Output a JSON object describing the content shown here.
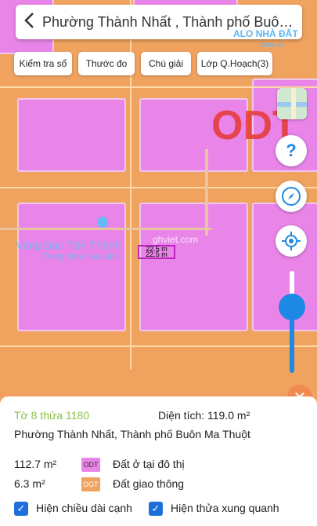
{
  "header": {
    "back_icon": "chevron-left-icon",
    "title": "Phường Thành Nhất , Thành phố Buôn Ma Thuột"
  },
  "watermark": {
    "brand": "ALO NHÀ ĐẤT",
    "domain": ".com.vn"
  },
  "toolbar": {
    "check_book": "Kiểm tra sổ",
    "measure": "Thước đo",
    "legend": "Chú giải",
    "planning_layer": "Lớp Q.Hoạch(3)"
  },
  "map": {
    "shop_label": "Vàng Bạc Tiến Thành",
    "mall_label": "Trung tâm mua sắm",
    "site_label": "ghviet.com",
    "dim_top": "22.5 m",
    "dim_bottom": "22.5 m",
    "zone_label": "ODT"
  },
  "controls": {
    "zoom_level": 0.35
  },
  "panel": {
    "parcel": "Tờ 8 thửa 1180",
    "area": "Diện tích: 119.0 m²",
    "address": "Phường Thành Nhất, Thành phố Buôn Ma Thuột",
    "land_uses": [
      {
        "amount": "112.7 m²",
        "code": "ODT",
        "name": "Đất ở tại đô thị",
        "color": "#e985e8"
      },
      {
        "amount": "6.3 m²",
        "code": "DGT",
        "name": "Đất giao thông",
        "color": "#f0a25f"
      }
    ],
    "show_edge_length": "Hiện chiều dài cạnh",
    "show_neighbors": "Hiện thửa xung quanh"
  },
  "colors": {
    "accent": "#1e88e5",
    "residential": "#e985e8",
    "traffic": "#f0a25f"
  }
}
